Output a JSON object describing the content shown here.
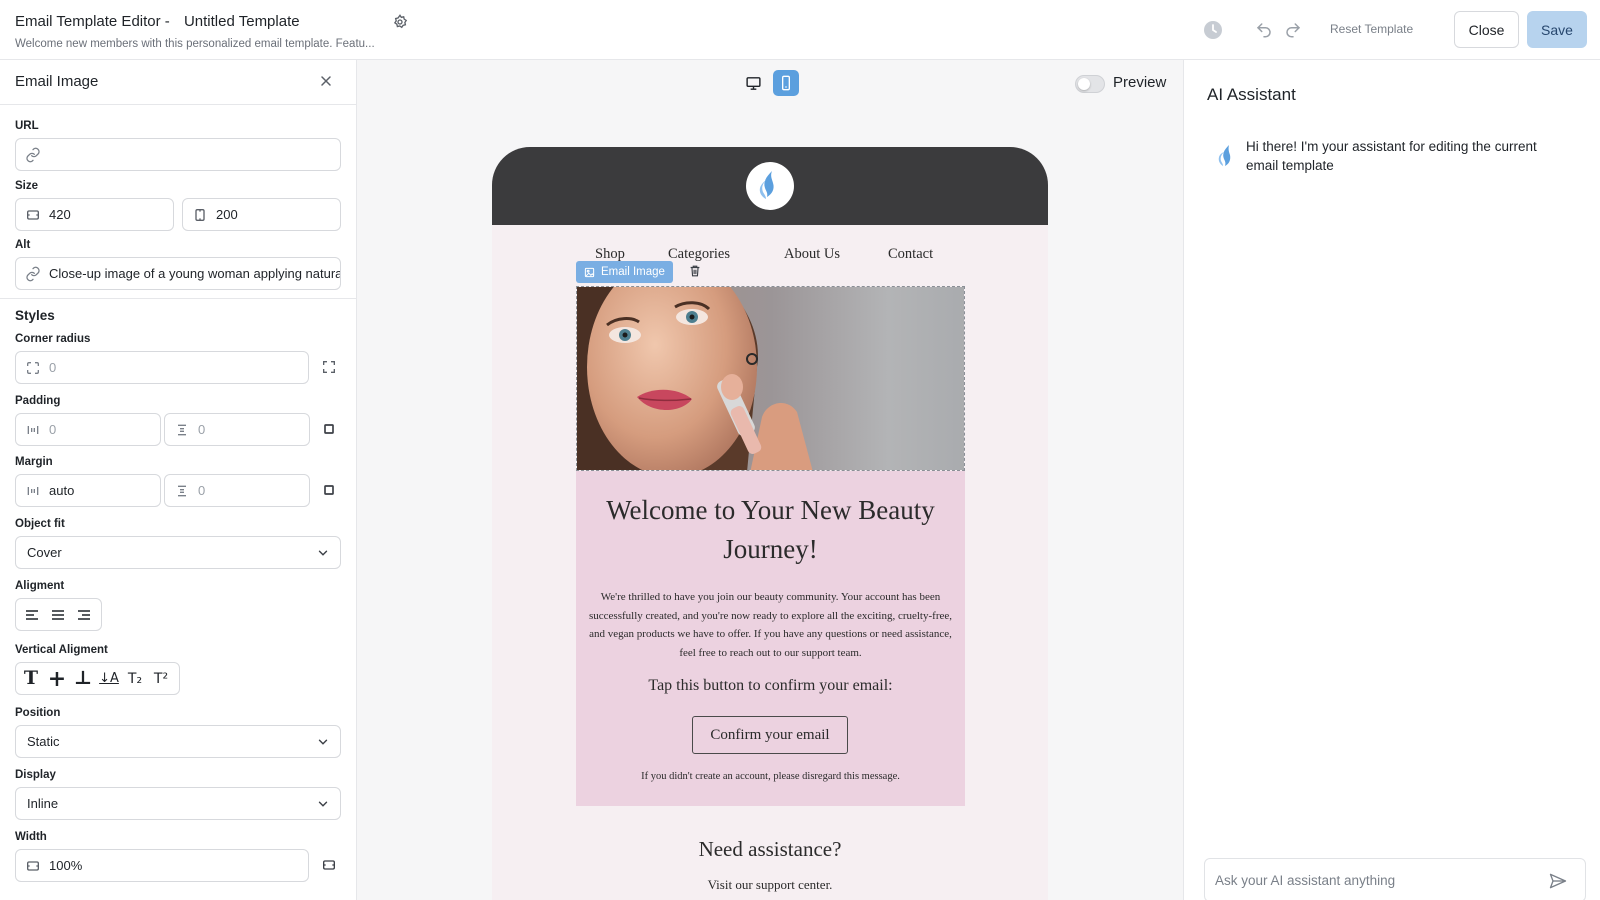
{
  "header": {
    "app_title": "Email Template Editor -",
    "template_name": "Untitled Template",
    "subtitle": "Welcome new members with this personalized email template. Featu...",
    "reset_label": "Reset Template",
    "close_label": "Close",
    "save_label": "Save"
  },
  "inspector": {
    "title": "Email Image",
    "url_label": "URL",
    "url_value": "",
    "size_label": "Size",
    "width_value": "420",
    "height_value": "200",
    "alt_label": "Alt",
    "alt_value": "Close-up image of a young woman applying natural makeup",
    "styles_title": "Styles",
    "corner_radius_label": "Corner radius",
    "corner_radius_value": "0",
    "padding_label": "Padding",
    "padding_x": "0",
    "padding_y": "0",
    "margin_label": "Margin",
    "margin_x": "auto",
    "margin_y": "0",
    "object_fit_label": "Object fit",
    "object_fit_value": "Cover",
    "alignment_label": "Aligment",
    "vertical_alignment_label": "Vertical Aligment",
    "vertical_glyphs": [
      "T",
      "+",
      "⊥",
      "↓A",
      "T₂",
      "T²"
    ],
    "position_label": "Position",
    "position_value": "Static",
    "display_label": "Display",
    "display_value": "Inline",
    "width_label": "Width",
    "width_pct_value": "100%"
  },
  "canvas": {
    "preview_label": "Preview",
    "preview_on": false,
    "selected_device": "mobile",
    "nav": [
      "Shop",
      "Categories",
      "About Us",
      "Contact"
    ],
    "selected_tag": "Email Image",
    "email_title": "Welcome to Your New Beauty Journey!",
    "email_body": "We're thrilled to have you join our beauty community. Your account has been successfully created, and you're now ready to explore all the exciting, cruelty-free, and vegan products we have to offer. If you have any questions or need assistance, feel free to reach out to our support team.",
    "tap_text": "Tap this button to confirm your email:",
    "confirm_label": "Confirm your email",
    "footer_note": "If you didn't create an account, please disregard this message.",
    "need_title": "Need assistance?",
    "visit_text": "Visit our support center."
  },
  "assistant": {
    "title": "AI Assistant",
    "message": "Hi there! I'm your assistant for editing the current email template",
    "input_placeholder": "Ask your AI assistant anything"
  },
  "colors": {
    "accent": "#5b9fde",
    "save_bg": "#b7d3ee",
    "email_header": "#3b3b3d",
    "email_content": "#ecd2e0",
    "email_bg": "#f6eff2"
  },
  "icons": [
    "settings-icon",
    "clock-icon",
    "undo-icon",
    "redo-icon",
    "close-icon",
    "link-icon",
    "width-icon",
    "height-icon",
    "corner-radius-icon",
    "expand-icon",
    "padding-x-icon",
    "padding-y-icon",
    "square-icon",
    "chevron-down-icon",
    "align-left-icon",
    "align-center-icon",
    "align-right-icon",
    "desktop-icon",
    "mobile-icon",
    "image-icon",
    "trash-icon",
    "flame-logo-icon",
    "send-icon"
  ]
}
